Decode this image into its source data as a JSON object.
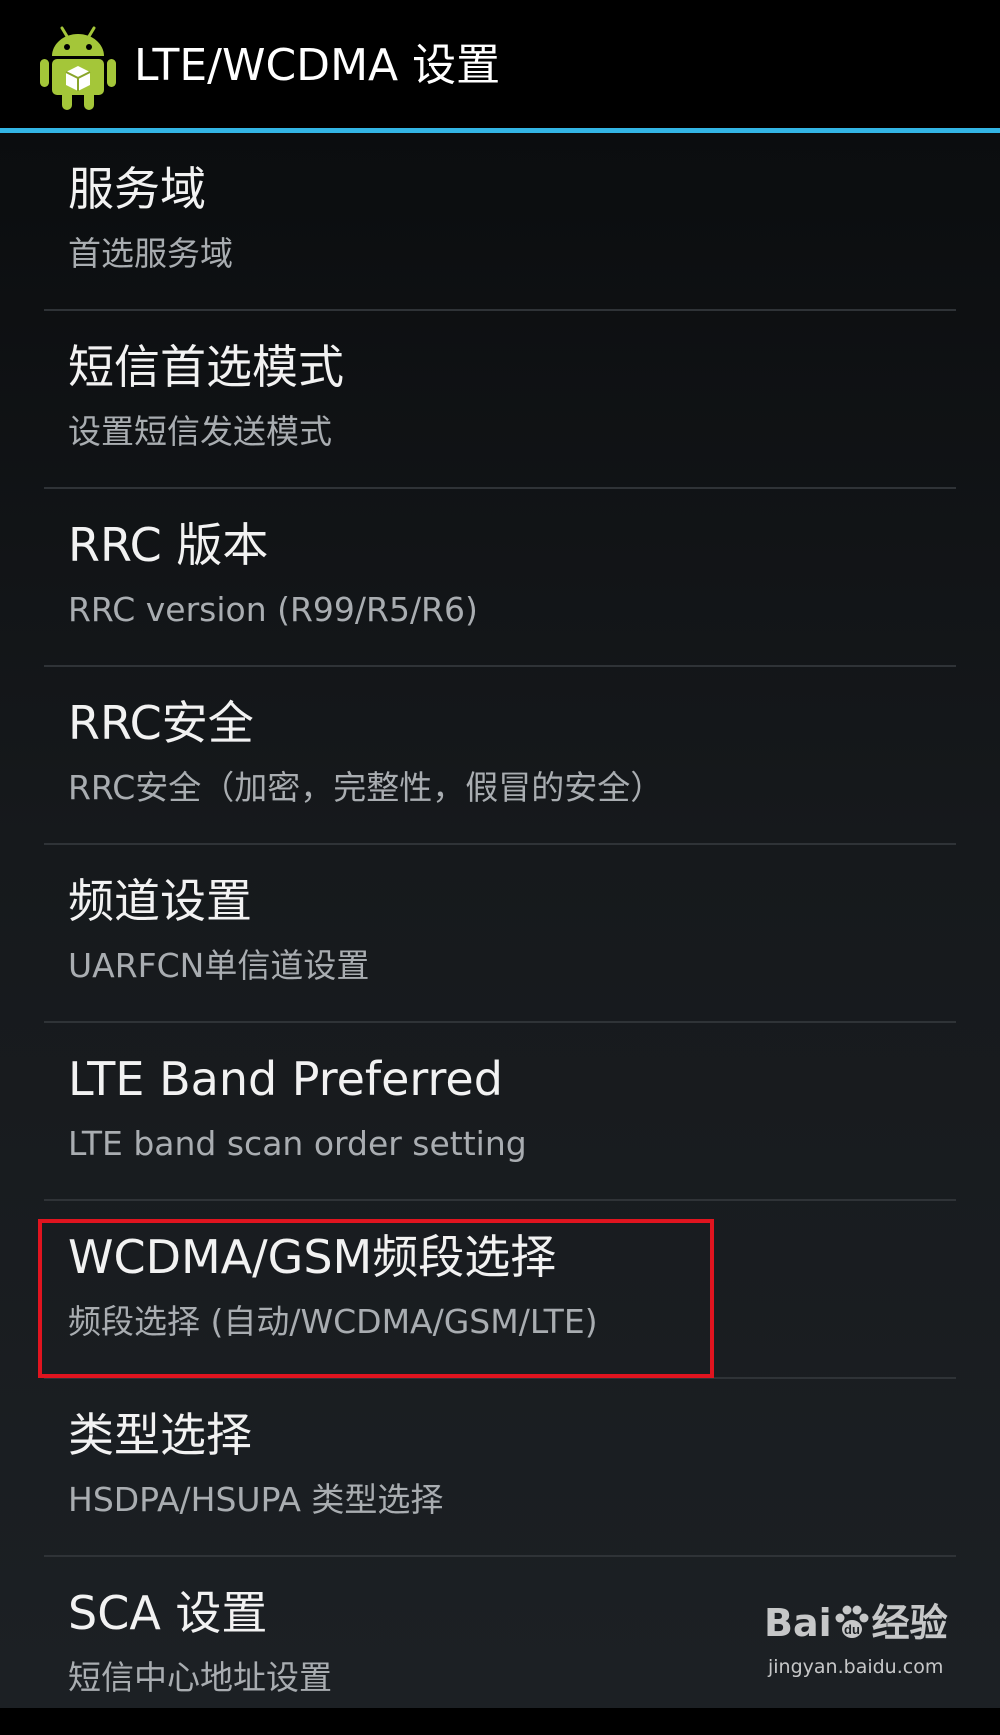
{
  "header": {
    "title": "LTE/WCDMA 设置",
    "icon": "android-robot-icon",
    "accent_color": "#33b5e5"
  },
  "preferences": [
    {
      "title": "服务域",
      "summary": "首选服务域"
    },
    {
      "title": "短信首选模式",
      "summary": "设置短信发送模式"
    },
    {
      "title": "RRC 版本",
      "summary": "RRC version (R99/R5/R6)"
    },
    {
      "title": "RRC安全",
      "summary": "RRC安全（加密，完整性，假冒的安全）"
    },
    {
      "title": "频道设置",
      "summary": "UARFCN单信道设置"
    },
    {
      "title": "LTE Band Preferred",
      "summary": "LTE band scan order setting"
    },
    {
      "title": "WCDMA/GSM频段选择",
      "summary": "频段选择 (自动/WCDMA/GSM/LTE)"
    },
    {
      "title": "类型选择",
      "summary": "HSDPA/HSUPA 类型选择"
    },
    {
      "title": "SCA 设置",
      "summary": "短信中心地址设置"
    }
  ],
  "annotation": {
    "highlight_color": "#e0141f"
  },
  "watermark": {
    "logo_text_left": "Bai",
    "logo_text_right": "经验",
    "url": "jingyan.baidu.com"
  }
}
